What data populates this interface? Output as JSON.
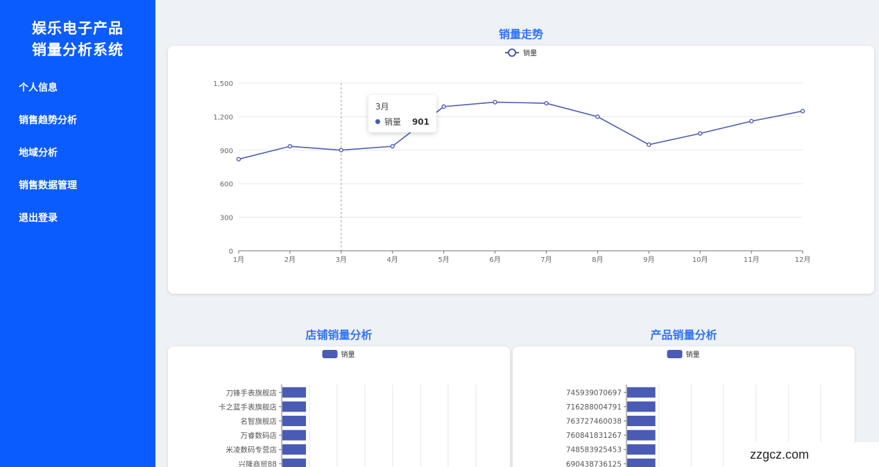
{
  "app": {
    "title_line1": "娱乐电子产品",
    "title_line2": "销量分析系统"
  },
  "nav": [
    {
      "label": "个人信息"
    },
    {
      "label": "销售趋势分析"
    },
    {
      "label": "地域分析"
    },
    {
      "label": "销售数据管理"
    },
    {
      "label": "退出登录"
    }
  ],
  "sections": {
    "trend_title": "销量走势",
    "store_title": "店铺销量分析",
    "product_title": "产品销量分析"
  },
  "tooltip": {
    "title": "3月",
    "series": "销量",
    "value": "901"
  },
  "colors": {
    "sidebar": "#0a5cff",
    "accent": "#2f73ff",
    "series": "#4a5bb5"
  },
  "watermark": "zzgcz.com",
  "chart_data": [
    {
      "type": "line",
      "title": "销量走势",
      "legend": [
        "销量"
      ],
      "legend_position": "top-center",
      "categories": [
        "1月",
        "2月",
        "3月",
        "4月",
        "5月",
        "6月",
        "7月",
        "8月",
        "9月",
        "10月",
        "11月",
        "12月"
      ],
      "series": [
        {
          "name": "销量",
          "values": [
            820,
            935,
            901,
            935,
            1290,
            1330,
            1320,
            1200,
            950,
            1050,
            1160,
            1250
          ]
        }
      ],
      "ylim": [
        0,
        1500
      ],
      "yticks": [
        "0",
        "300",
        "600",
        "900",
        "1,200",
        "1,500"
      ],
      "grid": true
    },
    {
      "type": "bar",
      "orientation": "horizontal",
      "title": "店铺销量分析",
      "legend": [
        "销量"
      ],
      "legend_position": "top-center",
      "categories": [
        "刀锋手表旗舰店",
        "卡之蓝手表旗舰店",
        "名智旗舰店",
        "万睿数码店",
        "米凌数码专营店",
        "兴隆商贸88"
      ],
      "series": [
        {
          "name": "销量",
          "values": [
            1,
            1,
            1,
            1,
            1,
            1
          ]
        }
      ],
      "xlim": [
        0,
        7
      ],
      "grid": true
    },
    {
      "type": "bar",
      "orientation": "horizontal",
      "title": "产品销量分析",
      "legend": [
        "销量"
      ],
      "legend_position": "top-center",
      "categories": [
        "745939070697",
        "716288004791",
        "763727460038",
        "760841831267",
        "748583925453",
        "690438736125"
      ],
      "series": [
        {
          "name": "销量",
          "values": [
            1,
            1,
            1,
            1,
            1,
            1
          ]
        }
      ],
      "xlim": [
        0,
        6
      ],
      "grid": true
    }
  ]
}
